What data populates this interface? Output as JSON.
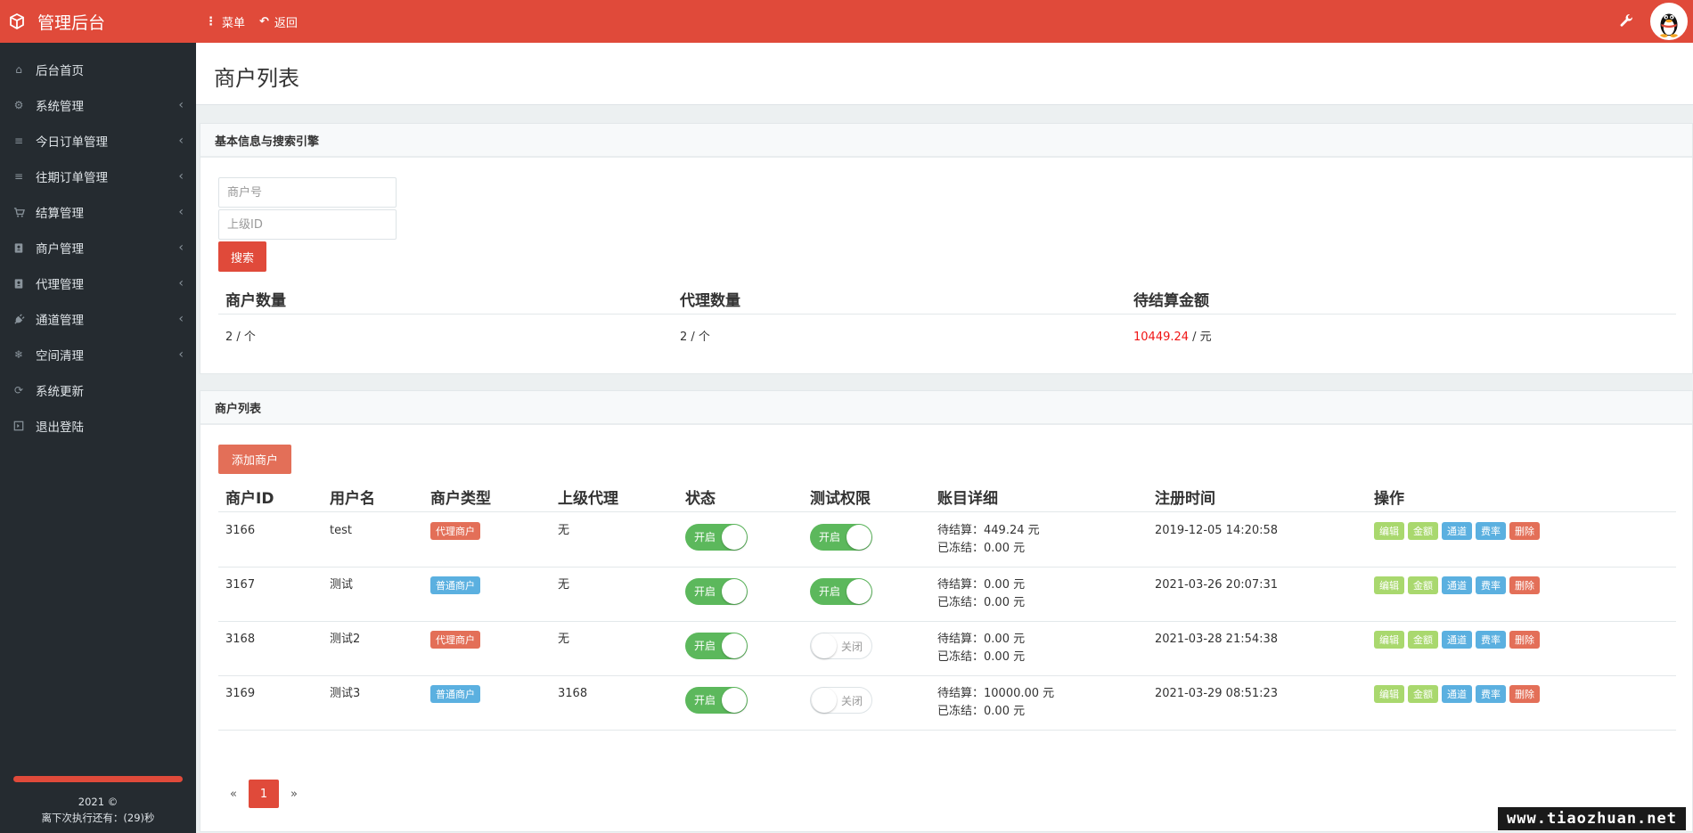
{
  "topbar": {
    "brand": "管理后台",
    "menu_label": "菜单",
    "back_label": "返回"
  },
  "sidebar": {
    "items": [
      {
        "label": "后台首页",
        "icon": "home-icon",
        "submenu": false
      },
      {
        "label": "系统管理",
        "icon": "gears-icon",
        "submenu": true
      },
      {
        "label": "今日订单管理",
        "icon": "list-icon",
        "submenu": true
      },
      {
        "label": "往期订单管理",
        "icon": "list-icon",
        "submenu": true
      },
      {
        "label": "结算管理",
        "icon": "cart-icon",
        "submenu": true
      },
      {
        "label": "商户管理",
        "icon": "contact-book-icon",
        "submenu": true
      },
      {
        "label": "代理管理",
        "icon": "contact-book-icon",
        "submenu": true
      },
      {
        "label": "通道管理",
        "icon": "plug-icon",
        "submenu": true
      },
      {
        "label": "空间清理",
        "icon": "snowflake-icon",
        "submenu": true
      },
      {
        "label": "系统更新",
        "icon": "refresh-icon",
        "submenu": false
      },
      {
        "label": "退出登陆",
        "icon": "logout-icon",
        "submenu": false
      }
    ],
    "footer_year": "2021 ©",
    "footer_countdown": "离下次执行还有：(29)秒"
  },
  "page": {
    "title": "商户列表"
  },
  "search_panel": {
    "title": "基本信息与搜索引擎",
    "merchant_no_placeholder": "商户号",
    "parent_id_placeholder": "上级ID",
    "search_button": "搜索",
    "stats_headers": [
      "商户数量",
      "代理数量",
      "待结算金额"
    ],
    "merchant_count": "2",
    "agent_count": "2",
    "count_unit": "/ 个",
    "pending_amount": "10449.24",
    "amount_unit": "/ 元"
  },
  "list_panel": {
    "title": "商户列表",
    "add_button": "添加商户",
    "columns": [
      "商户ID",
      "用户名",
      "商户类型",
      "上级代理",
      "状态",
      "测试权限",
      "账目详细",
      "注册时间",
      "操作"
    ],
    "pending_prefix": "待结算：",
    "frozen_prefix": "已冻结：",
    "rows": [
      {
        "id": "3166",
        "username": "test",
        "type": "代理商户",
        "type_color": "#e36f58",
        "parent": "无",
        "status": "开启",
        "status_on": true,
        "test": "开启",
        "test_on": true,
        "pending": "449.24 元",
        "frozen": "0.00 元",
        "registered": "2019-12-05 14:20:58"
      },
      {
        "id": "3167",
        "username": "测试",
        "type": "普通商户",
        "type_color": "#5bb0e0",
        "parent": "无",
        "status": "开启",
        "status_on": true,
        "test": "开启",
        "test_on": true,
        "pending": "0.00 元",
        "frozen": "0.00 元",
        "registered": "2021-03-26 20:07:31"
      },
      {
        "id": "3168",
        "username": "测试2",
        "type": "代理商户",
        "type_color": "#e36f58",
        "parent": "无",
        "status": "开启",
        "status_on": true,
        "test": "关闭",
        "test_on": false,
        "pending": "0.00 元",
        "frozen": "0.00 元",
        "registered": "2021-03-28 21:54:38"
      },
      {
        "id": "3169",
        "username": "测试3",
        "type": "普通商户",
        "type_color": "#5bb0e0",
        "parent": "3168",
        "status": "开启",
        "status_on": true,
        "test": "关闭",
        "test_on": false,
        "pending": "10000.00 元",
        "frozen": "0.00 元",
        "registered": "2021-03-29 08:51:23"
      }
    ],
    "actions": [
      {
        "label": "编辑",
        "color": "#a9d86e"
      },
      {
        "label": "金额",
        "color": "#a9d86e"
      },
      {
        "label": "通道",
        "color": "#5bb0e0"
      },
      {
        "label": "费率",
        "color": "#5bb0e0"
      },
      {
        "label": "删除",
        "color": "#e36f58"
      }
    ],
    "pager": {
      "prev": "«",
      "current": "1",
      "next": "»"
    }
  },
  "watermark": "www.tiaozhuan.net",
  "colors": {
    "brand": "#e04a3a",
    "sidebar_bg": "#252b30",
    "toggle_on": "#5cb85c"
  }
}
